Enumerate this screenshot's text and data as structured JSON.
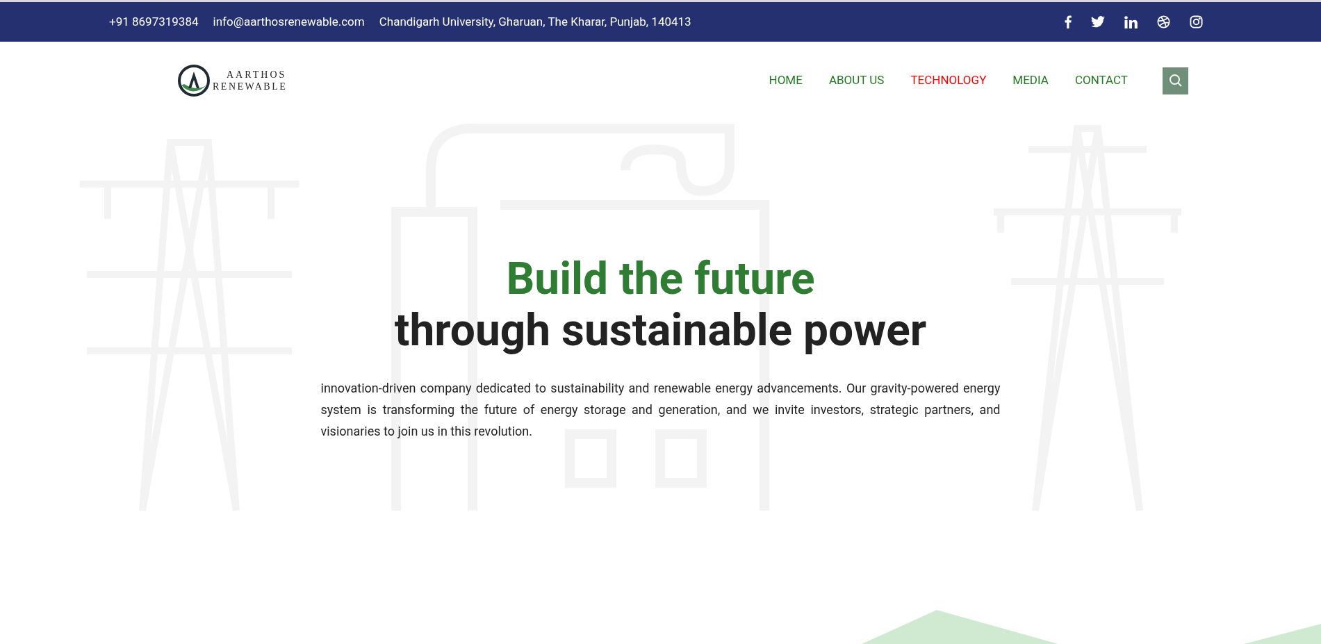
{
  "top_bar": {
    "phone": "+91 8697319384",
    "email": "info@aarthosrenewable.com",
    "address": "Chandigarh University, Gharuan, The Kharar, Punjab, 140413",
    "social": [
      {
        "kind": "facebook"
      },
      {
        "kind": "twitter"
      },
      {
        "kind": "linkedin"
      },
      {
        "kind": "dribbble"
      },
      {
        "kind": "instagram"
      }
    ]
  },
  "logo": {
    "line_1": "AARTHOS",
    "line_2": "RENEWABLE"
  },
  "nav": [
    {
      "label": "HOME",
      "selected": false
    },
    {
      "label": "ABOUT US",
      "selected": false
    },
    {
      "label": "TECHNOLOGY",
      "selected": true
    },
    {
      "label": "MEDIA",
      "selected": false
    },
    {
      "label": "CONTACT",
      "selected": false
    }
  ],
  "hero": {
    "title_1": "Build the future",
    "title_2": "through sustainable power",
    "text": "innovation-driven company dedicated to sustainability and renewable energy advancements. Our gravity-powered energy system is transforming the future of energy storage and generation, and we invite investors, strategic partners, and visionaries to join us in this revolution."
  }
}
